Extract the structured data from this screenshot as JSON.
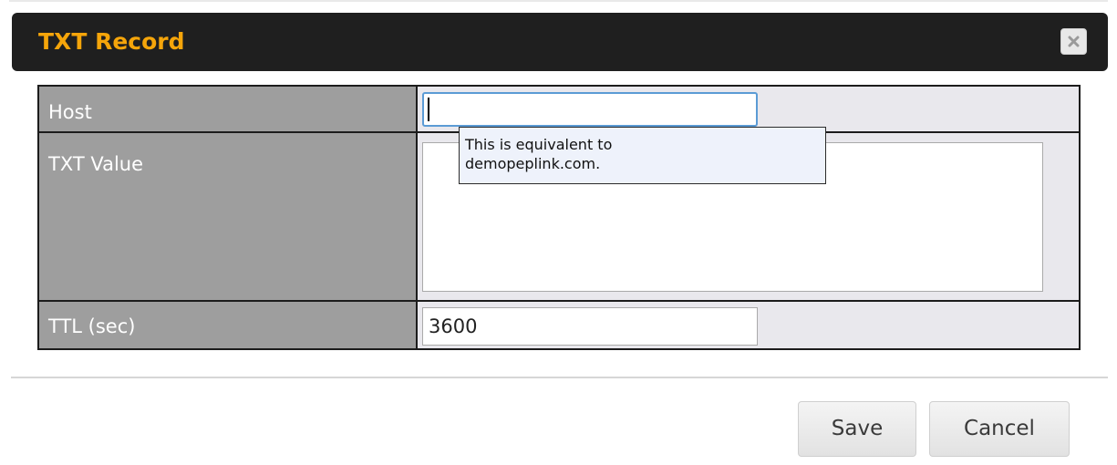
{
  "dialog": {
    "title": "TXT Record",
    "close_icon": "close-x-icon"
  },
  "form": {
    "host": {
      "label": "Host",
      "value": ""
    },
    "txt_value": {
      "label": "TXT Value",
      "value": ""
    },
    "ttl": {
      "label": "TTL (sec)",
      "value": "3600"
    }
  },
  "tooltip": {
    "line1": "This is equivalent to",
    "line2": "demopeplink.com."
  },
  "buttons": {
    "save_label": "Save",
    "cancel_label": "Cancel"
  },
  "colors": {
    "title_accent": "#f5a50a",
    "titlebar_bg": "#1f1f1f",
    "label_bg": "#9e9e9e",
    "focus_border": "#5b9bd5"
  }
}
